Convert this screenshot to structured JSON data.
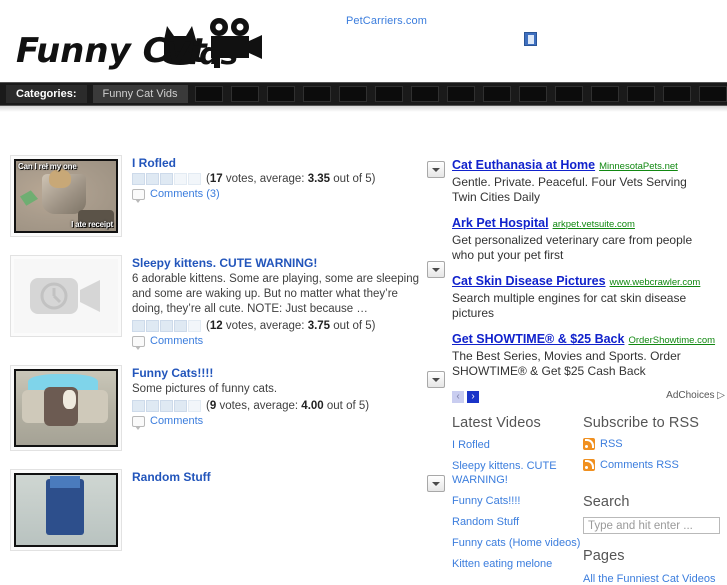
{
  "site": {
    "logo_text": "Funny Cat Vids",
    "top_ad_link": "PetCarriers.com"
  },
  "categories_bar": {
    "label": "Categories:",
    "items": [
      "Funny Cat Vids"
    ]
  },
  "posts": [
    {
      "title": "I Rofled",
      "excerpt": "",
      "votes": "17",
      "average": "3.35",
      "rating_prefix": "(",
      "votes_word": "votes, average:",
      "out_of": "out of 5)",
      "comments_label": "Comments (3)",
      "filled_stars": 3,
      "thumb_type": "meme",
      "meme_top_text": "Can I reł my one",
      "meme_bottom_text": "I ate receipt"
    },
    {
      "title": "Sleepy kittens. CUTE WARNING!",
      "excerpt": "6 adorable kittens. Some are playing, some are sleeping and some are waking up. But no matter what they’re doing, they’re all cute. NOTE: Just because …",
      "votes": "12",
      "average": "3.75",
      "rating_prefix": "(",
      "votes_word": "votes, average:",
      "out_of": "out of 5)",
      "comments_label": "Comments",
      "filled_stars": 4,
      "thumb_type": "placeholder"
    },
    {
      "title": "Funny Cats!!!!",
      "excerpt": "Some pictures of funny cats.",
      "votes": "9",
      "average": "4.00",
      "rating_prefix": "(",
      "votes_word": "votes, average:",
      "out_of": "out of 5)",
      "comments_label": "Comments",
      "filled_stars": 4,
      "thumb_type": "cats"
    },
    {
      "title": "Random Stuff",
      "excerpt": "",
      "votes": "",
      "average": "",
      "rating_prefix": "",
      "votes_word": "",
      "out_of": "",
      "comments_label": "",
      "filled_stars": 0,
      "thumb_type": "random"
    }
  ],
  "ads": {
    "items": [
      {
        "title": "Cat Euthanasia at Home",
        "url": "MinnesotaPets.net",
        "desc": "Gentle. Private. Peaceful. Four Vets Serving Twin Cities Daily"
      },
      {
        "title": "Ark Pet Hospital",
        "url": "arkpet.vetsuite.com",
        "desc": "Get personalized veterinary care from people who put your pet first"
      },
      {
        "title": "Cat Skin Disease Pictures",
        "url": "www.webcrawler.com",
        "desc": "Search multiple engines for cat skin disease pictures"
      },
      {
        "title": "Get SHOWTIME® & $25 Back",
        "url": "OrderShowtime.com",
        "desc": "The Best Series, Movies and Sports. Order SHOWTIME® & Get $25 Cash Back"
      }
    ],
    "prev_arrow": "‹",
    "next_arrow": "›",
    "adchoices_label": "AdChoices",
    "adchoices_mark": "▷"
  },
  "widgets": {
    "latest_videos": {
      "title": "Latest Videos",
      "items": [
        "I Rofled",
        "Sleepy kittens. CUTE WARNING!",
        "Funny Cats!!!!",
        "Random Stuff",
        "Funny cats (Home videos)",
        "Kitten eating melone"
      ]
    },
    "subscribe": {
      "title": "Subscribe to RSS",
      "rss_label": "RSS",
      "comments_rss_label": "Comments RSS"
    },
    "search": {
      "title": "Search",
      "placeholder": "Type and hit enter ...",
      "value": ""
    },
    "pages": {
      "title": "Pages",
      "items": [
        "All the Funniest Cat Videos"
      ]
    }
  }
}
